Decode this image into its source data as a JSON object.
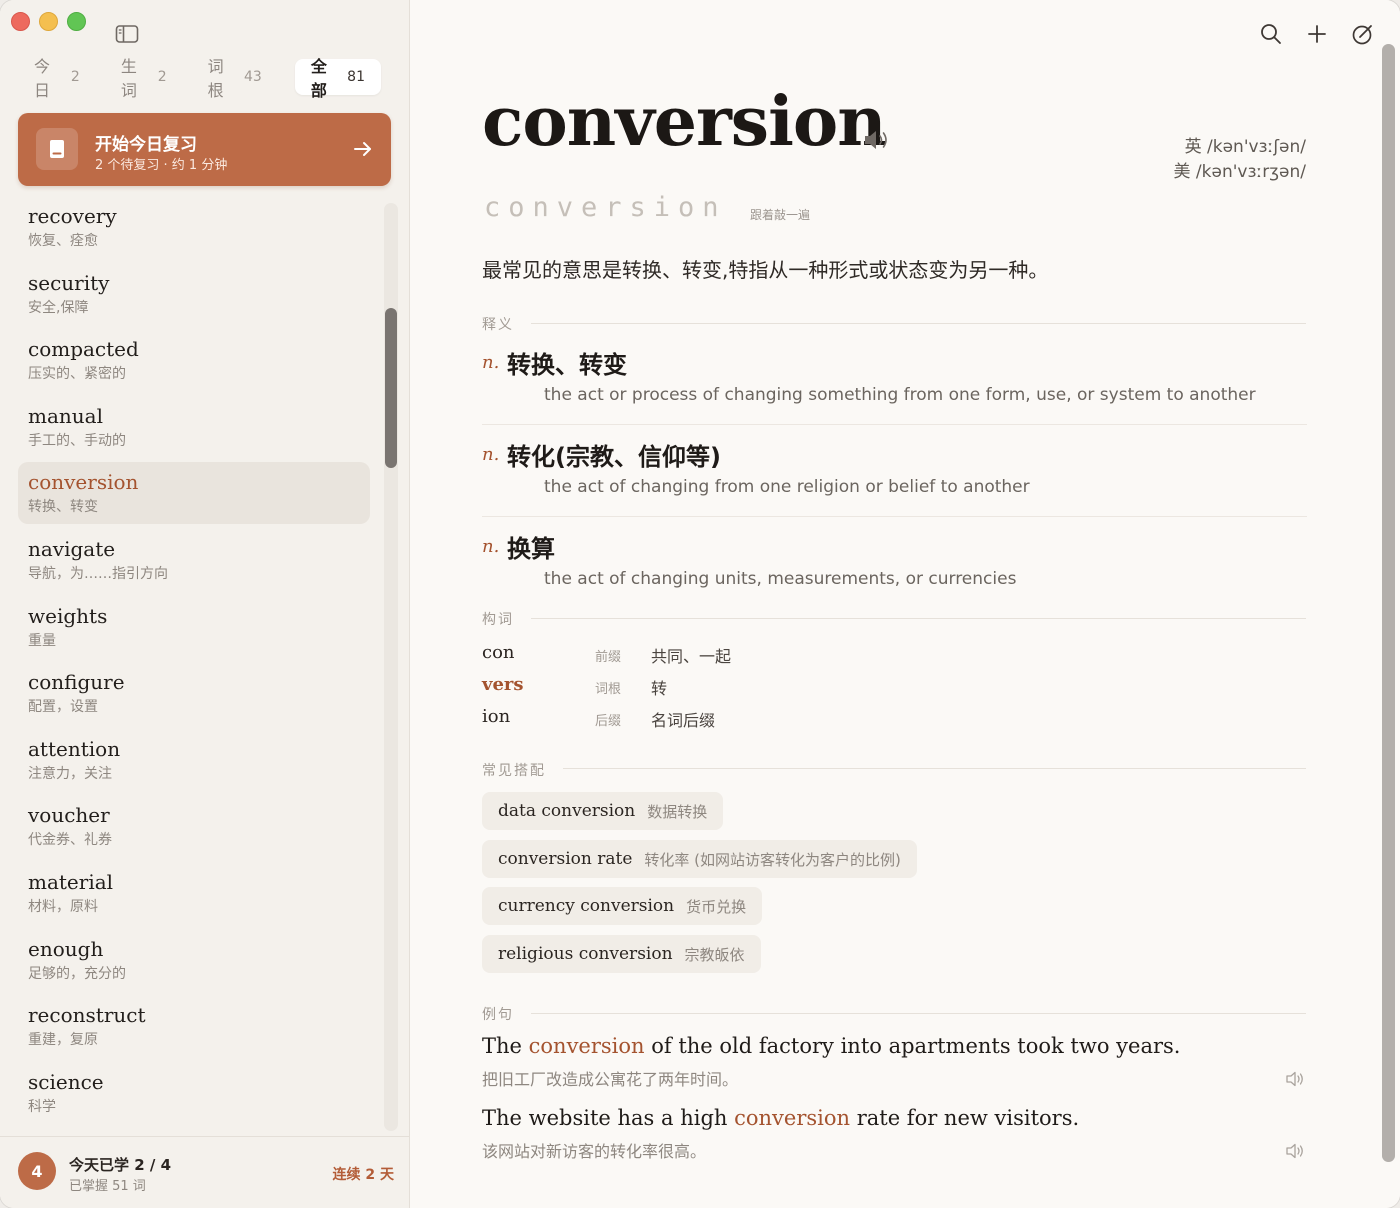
{
  "sidebar": {
    "tabs": [
      {
        "label": "今日",
        "count": "2"
      },
      {
        "label": "生词",
        "count": "2"
      },
      {
        "label": "词根",
        "count": "43"
      },
      {
        "label": "全部",
        "count": "81"
      }
    ],
    "review": {
      "title": "开始今日复习",
      "subtitle": "2 个待复习 · 约 1 分钟"
    },
    "words": [
      {
        "en": "recovery",
        "cn": "恢复、痊愈"
      },
      {
        "en": "security",
        "cn": "安全,保障"
      },
      {
        "en": "compacted",
        "cn": "压实的、紧密的"
      },
      {
        "en": "manual",
        "cn": "手工的、手动的"
      },
      {
        "en": "conversion",
        "cn": "转换、转变"
      },
      {
        "en": "navigate",
        "cn": "导航，为……指引方向"
      },
      {
        "en": "weights",
        "cn": "重量"
      },
      {
        "en": "configure",
        "cn": "配置，设置"
      },
      {
        "en": "attention",
        "cn": "注意力，关注"
      },
      {
        "en": "voucher",
        "cn": "代金券、礼券"
      },
      {
        "en": "material",
        "cn": "材料，原料"
      },
      {
        "en": "enough",
        "cn": "足够的，充分的"
      },
      {
        "en": "reconstruct",
        "cn": "重建，复原"
      },
      {
        "en": "science",
        "cn": "科学"
      }
    ],
    "footer": {
      "badge": "4",
      "learned": "今天已学 2 / 4",
      "mastered": "已掌握 51 词",
      "streak": "连续 2 天"
    }
  },
  "main": {
    "word": "conversion",
    "phonetic_uk": "英 /kən'vɜːʃən/",
    "phonetic_us": "美 /kən'vɜːrʒən/",
    "spelling": "conversion",
    "spell_hint": "跟着敲一遍",
    "summary": "最常见的意思是转换、转变,特指从一种形式或状态变为另一种。",
    "sections": {
      "definitions": "释义",
      "morphology": "构词",
      "collocations": "常见搭配",
      "examples": "例句"
    },
    "definitions": [
      {
        "pos": "n.",
        "cn": "转换、转变",
        "en": "the act or process of changing something from one form, use, or system to another"
      },
      {
        "pos": "n.",
        "cn": "转化(宗教、信仰等)",
        "en": "the act of changing from one religion or belief to another"
      },
      {
        "pos": "n.",
        "cn": "换算",
        "en": "the act of changing units, measurements, or currencies"
      }
    ],
    "morphology": [
      {
        "part": "con",
        "type": "前缀",
        "meaning": "共同、一起"
      },
      {
        "part": "vers",
        "type": "词根",
        "meaning": "转"
      },
      {
        "part": "ion",
        "type": "后缀",
        "meaning": "名词后缀"
      }
    ],
    "collocations": [
      {
        "en": "data conversion",
        "cn": "数据转换"
      },
      {
        "en": "conversion rate",
        "cn": "转化率 (如网站访客转化为客户的比例)"
      },
      {
        "en": "currency conversion",
        "cn": "货币兑换"
      },
      {
        "en": "religious conversion",
        "cn": "宗教皈依"
      }
    ],
    "examples": [
      {
        "pre": "The ",
        "hl": "conversion",
        "post": " of the old factory into apartments took two years.",
        "cn": "把旧工厂改造成公寓花了两年时间。"
      },
      {
        "pre": "The website has a high ",
        "hl": "conversion",
        "post": " rate for new visitors.",
        "cn": "该网站对新访客的转化率很高。"
      }
    ]
  },
  "colors": {
    "accent": "#bd6b47",
    "highlight": "#a4532f",
    "sidebar_bg": "#f4f1ec",
    "main_bg": "#fbf9f6"
  }
}
